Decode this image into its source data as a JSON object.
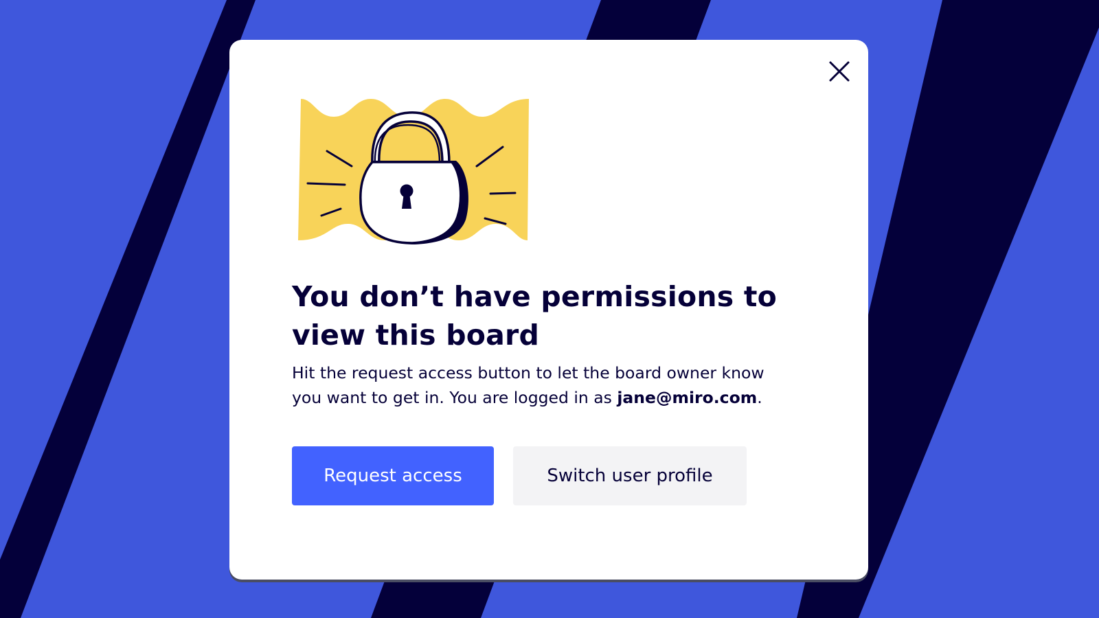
{
  "colors": {
    "background_blue": "#3f57dc",
    "stripe_navy": "#04003a",
    "modal_bg": "#ffffff",
    "illustration_yellow": "#f8d359",
    "text_dark": "#050038",
    "primary_button": "#4262ff",
    "secondary_button": "#f3f3f5"
  },
  "modal": {
    "close_icon": "close-icon",
    "illustration_icon": "padlock-icon",
    "title": "You don’t have permissions to view this board",
    "description_prefix": "Hit the request access button to let the board owner know you want to get in. You are logged in as ",
    "user_email": "jane@miro.com",
    "description_suffix": ".",
    "primary_button_label": "Request access",
    "secondary_button_label": "Switch user profile"
  }
}
